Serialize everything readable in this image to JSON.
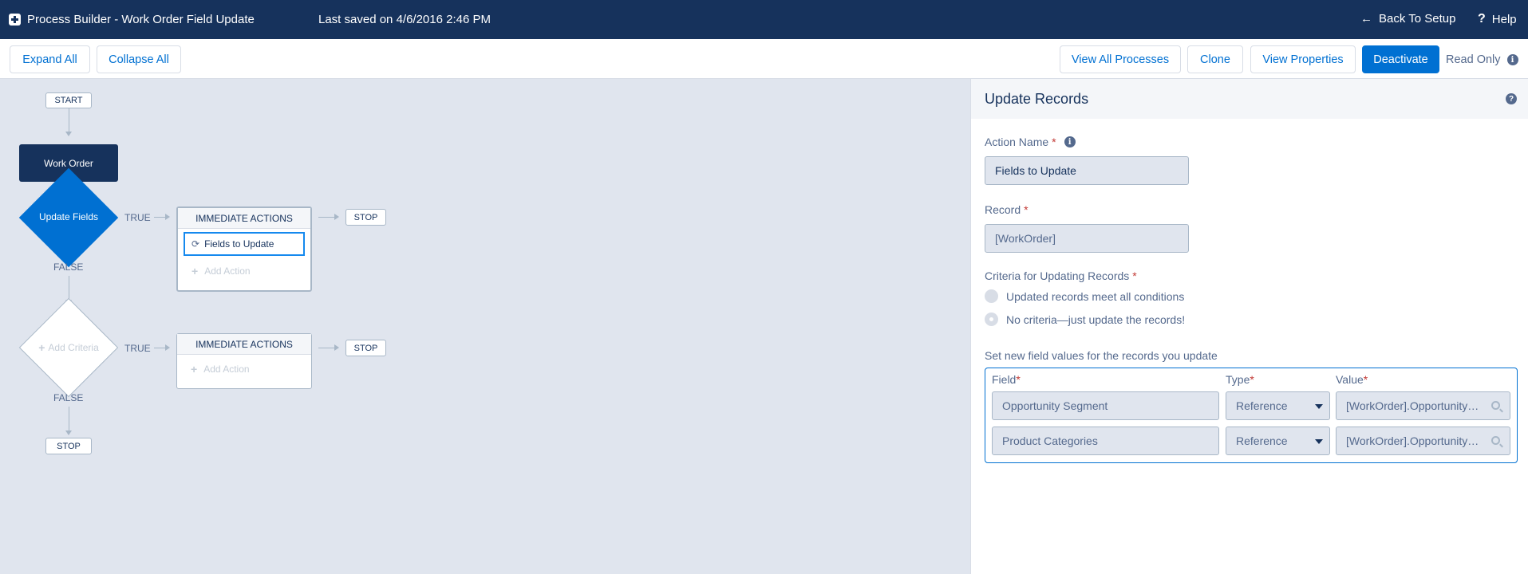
{
  "header": {
    "title": "Process Builder - Work Order Field Update",
    "saved": "Last saved on 4/6/2016 2:46 PM",
    "back_label": "Back To Setup",
    "help_label": "Help"
  },
  "toolbar": {
    "expand_all": "Expand All",
    "collapse_all": "Collapse All",
    "view_all_processes": "View All Processes",
    "clone": "Clone",
    "view_properties": "View Properties",
    "deactivate": "Deactivate",
    "read_only": "Read Only"
  },
  "canvas": {
    "start": "START",
    "object_node": "Work Order",
    "criteria_1": "Update Fields",
    "criteria_2": "Add Criteria",
    "true_label": "TRUE",
    "false_label": "FALSE",
    "immediate_actions": "IMMEDIATE ACTIONS",
    "action_1": "Fields to Update",
    "add_action": "Add Action",
    "stop": "STOP"
  },
  "panel": {
    "title": "Update Records",
    "action_name_label": "Action Name",
    "action_name_value": "Fields to Update",
    "record_label": "Record",
    "record_value": "[WorkOrder]",
    "criteria_label": "Criteria for Updating Records",
    "criteria_options": [
      {
        "label": "Updated records meet all conditions",
        "selected": false
      },
      {
        "label": "No criteria—just update the records!",
        "selected": true
      }
    ],
    "field_values_label": "Set new field values for the records you update",
    "columns": {
      "field": "Field",
      "type": "Type",
      "value": "Value"
    },
    "rows": [
      {
        "field": "Opportunity Segment",
        "type": "Reference",
        "value": "[WorkOrder].Opportunity…"
      },
      {
        "field": "Product Categories",
        "type": "Reference",
        "value": "[WorkOrder].Opportunity…"
      }
    ]
  },
  "colors": {
    "header_bg": "#16325c",
    "brand": "#0070d2",
    "canvas_bg": "#e0e5ee"
  }
}
